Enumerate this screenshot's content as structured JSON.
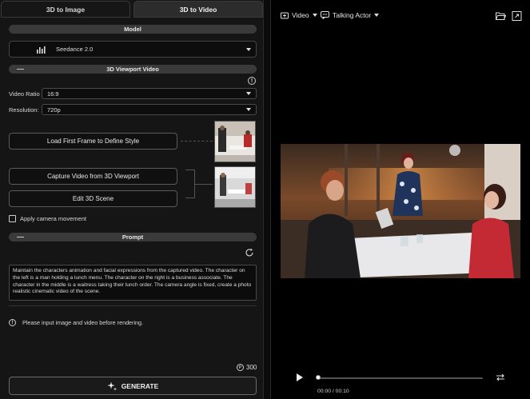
{
  "tabs": [
    {
      "label": "3D to Image",
      "active": false
    },
    {
      "label": "3D to Video",
      "active": true
    }
  ],
  "model": {
    "header": "Model",
    "selected": "Seedance 2.0",
    "icon": "bars-logo-icon"
  },
  "viewport": {
    "header": "3D Viewport Video",
    "collapse_symbol": "—",
    "video_ratio_label": "Video Ratio",
    "video_ratio_value": "16:9",
    "resolution_label": "Resolution:",
    "resolution_value": "720p",
    "load_first_frame_label": "Load First Frame to Define Style",
    "capture_label": "Capture Video from 3D Viewport",
    "edit_scene_label": "Edit 3D Scene",
    "camera_movement_label": "Apply camera movement",
    "camera_movement_checked": false
  },
  "prompt": {
    "header": "Prompt",
    "collapse_symbol": "—",
    "text": "Maintain the characters animation and facial expressions from the captured video. The character on the left is a man holding a lunch menu. The character on the right is a business associate. The character in the middle is a waitress taking their lunch order. The camera angle is fixed, create a photo realistic cinematic video of the scene."
  },
  "status": {
    "message": "Please input image and video before rendering.",
    "info_symbol": "!"
  },
  "credits": {
    "value": "300",
    "coin_symbol": "P"
  },
  "generate": {
    "label": "GENERATE",
    "icon": "sparkle-icon"
  },
  "player": {
    "mode_label": "Video",
    "actor_label": "Talking Actor",
    "time": "00:00 / 00:10",
    "progress": 0.0
  },
  "colors": {
    "panel_bg": "#151515",
    "header_bg": "#3a3a3a",
    "viewer_bg": "#000000"
  }
}
